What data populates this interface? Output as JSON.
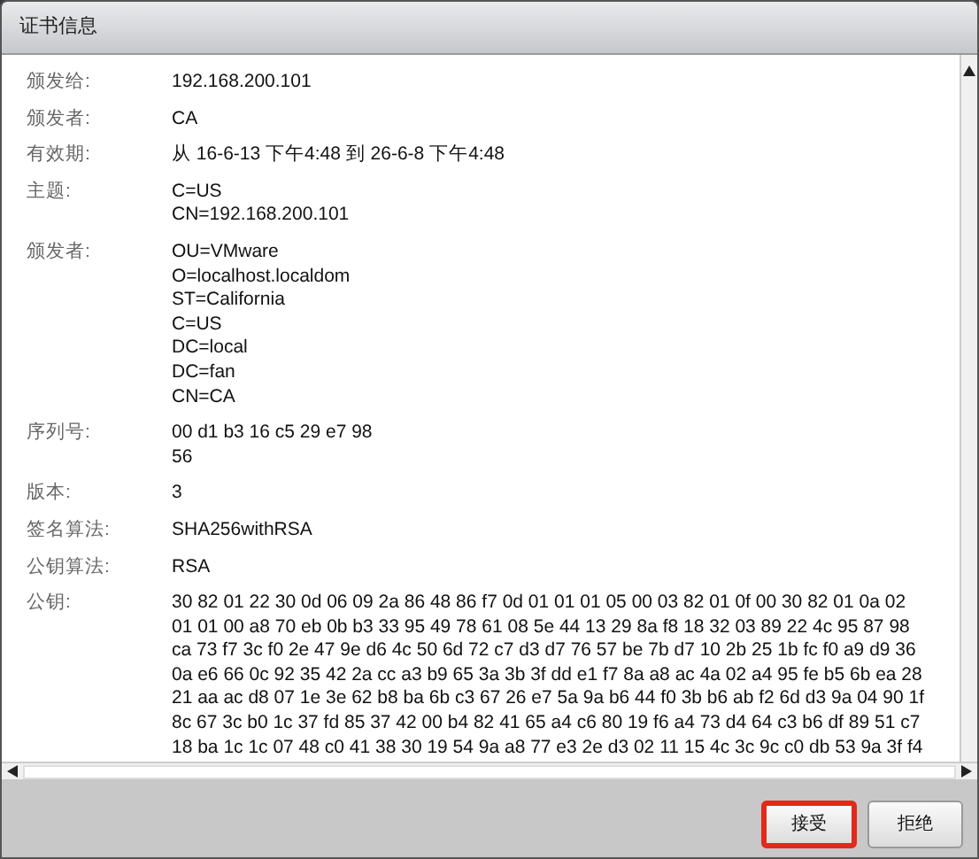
{
  "window": {
    "title": "证书信息"
  },
  "fields": [
    {
      "label": "颁发给:",
      "lines": [
        "192.168.200.101"
      ]
    },
    {
      "label": "颁发者:",
      "lines": [
        "CA"
      ]
    },
    {
      "label": "有效期:",
      "lines": [
        "从 16-6-13 下午4:48 到 26-6-8 下午4:48"
      ]
    },
    {
      "label": "主题:",
      "lines": [
        "C=US",
        "CN=192.168.200.101"
      ]
    },
    {
      "label": "颁发者:",
      "lines": [
        "OU=VMware",
        "O=localhost.localdom",
        "ST=California",
        "C=US",
        "DC=local",
        "DC=fan",
        "CN=CA"
      ]
    },
    {
      "label": "序列号:",
      "lines": [
        "00 d1 b3 16 c5 29 e7 98",
        "56"
      ]
    },
    {
      "label": "版本:",
      "lines": [
        "3"
      ]
    },
    {
      "label": "签名算法:",
      "lines": [
        "SHA256withRSA"
      ]
    },
    {
      "label": "公钥算法:",
      "lines": [
        "RSA"
      ]
    },
    {
      "label": "公钥:",
      "lines": [
        "30 82 01 22 30 0d 06 09 2a 86 48 86 f7 0d 01 01 01 05 00 03 82 01 0f 00 30 82 01 0a 02",
        "01 01 00 a8 70 eb 0b b3 33 95 49 78 61 08 5e 44 13 29 8a f8 18 32 03 89 22 4c 95 87 98",
        "ca 73 f7 3c f0 2e 47 9e d6 4c 50 6d 72 c7 d3 d7 76 57 be 7b d7 10 2b 25 1b fc f0 a9 d9 36",
        "0a e6 66 0c 92 35 42 2a cc a3 b9 65 3a 3b 3f dd e1 f7 8a a8 ac 4a 02 a4 95 fe b5 6b ea 28",
        "21 aa ac d8 07 1e 3e 62 b8 ba 6b c3 67 26 e7 5a 9a b6 44 f0 3b b6 ab f2 6d d3 9a 04 90 1f",
        "8c 67 3c b0 1c 37 fd 85 37 42 00 b4 82 41 65 a4 c6 80 19 f6 a4 73 d4 64 c3 b6 df 89 51 c7",
        "18 ba 1c 1c 07 48 c0 41 38 30 19 54 9a a8 77 e3 2e d3 02 11 15 4c 3c 9c c0 db 53 9a 3f f4"
      ]
    }
  ],
  "buttons": [
    {
      "label": "接受",
      "highlighted": true
    },
    {
      "label": "拒绝",
      "highlighted": false
    }
  ]
}
